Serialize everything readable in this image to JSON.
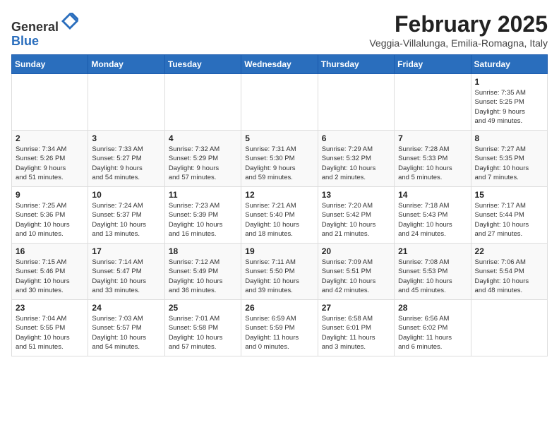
{
  "header": {
    "logo_line1": "General",
    "logo_line2": "Blue",
    "month_year": "February 2025",
    "location": "Veggia-Villalunga, Emilia-Romagna, Italy"
  },
  "weekdays": [
    "Sunday",
    "Monday",
    "Tuesday",
    "Wednesday",
    "Thursday",
    "Friday",
    "Saturday"
  ],
  "weeks": [
    [
      {
        "day": "",
        "info": ""
      },
      {
        "day": "",
        "info": ""
      },
      {
        "day": "",
        "info": ""
      },
      {
        "day": "",
        "info": ""
      },
      {
        "day": "",
        "info": ""
      },
      {
        "day": "",
        "info": ""
      },
      {
        "day": "1",
        "info": "Sunrise: 7:35 AM\nSunset: 5:25 PM\nDaylight: 9 hours\nand 49 minutes."
      }
    ],
    [
      {
        "day": "2",
        "info": "Sunrise: 7:34 AM\nSunset: 5:26 PM\nDaylight: 9 hours\nand 51 minutes."
      },
      {
        "day": "3",
        "info": "Sunrise: 7:33 AM\nSunset: 5:27 PM\nDaylight: 9 hours\nand 54 minutes."
      },
      {
        "day": "4",
        "info": "Sunrise: 7:32 AM\nSunset: 5:29 PM\nDaylight: 9 hours\nand 57 minutes."
      },
      {
        "day": "5",
        "info": "Sunrise: 7:31 AM\nSunset: 5:30 PM\nDaylight: 9 hours\nand 59 minutes."
      },
      {
        "day": "6",
        "info": "Sunrise: 7:29 AM\nSunset: 5:32 PM\nDaylight: 10 hours\nand 2 minutes."
      },
      {
        "day": "7",
        "info": "Sunrise: 7:28 AM\nSunset: 5:33 PM\nDaylight: 10 hours\nand 5 minutes."
      },
      {
        "day": "8",
        "info": "Sunrise: 7:27 AM\nSunset: 5:35 PM\nDaylight: 10 hours\nand 7 minutes."
      }
    ],
    [
      {
        "day": "9",
        "info": "Sunrise: 7:25 AM\nSunset: 5:36 PM\nDaylight: 10 hours\nand 10 minutes."
      },
      {
        "day": "10",
        "info": "Sunrise: 7:24 AM\nSunset: 5:37 PM\nDaylight: 10 hours\nand 13 minutes."
      },
      {
        "day": "11",
        "info": "Sunrise: 7:23 AM\nSunset: 5:39 PM\nDaylight: 10 hours\nand 16 minutes."
      },
      {
        "day": "12",
        "info": "Sunrise: 7:21 AM\nSunset: 5:40 PM\nDaylight: 10 hours\nand 18 minutes."
      },
      {
        "day": "13",
        "info": "Sunrise: 7:20 AM\nSunset: 5:42 PM\nDaylight: 10 hours\nand 21 minutes."
      },
      {
        "day": "14",
        "info": "Sunrise: 7:18 AM\nSunset: 5:43 PM\nDaylight: 10 hours\nand 24 minutes."
      },
      {
        "day": "15",
        "info": "Sunrise: 7:17 AM\nSunset: 5:44 PM\nDaylight: 10 hours\nand 27 minutes."
      }
    ],
    [
      {
        "day": "16",
        "info": "Sunrise: 7:15 AM\nSunset: 5:46 PM\nDaylight: 10 hours\nand 30 minutes."
      },
      {
        "day": "17",
        "info": "Sunrise: 7:14 AM\nSunset: 5:47 PM\nDaylight: 10 hours\nand 33 minutes."
      },
      {
        "day": "18",
        "info": "Sunrise: 7:12 AM\nSunset: 5:49 PM\nDaylight: 10 hours\nand 36 minutes."
      },
      {
        "day": "19",
        "info": "Sunrise: 7:11 AM\nSunset: 5:50 PM\nDaylight: 10 hours\nand 39 minutes."
      },
      {
        "day": "20",
        "info": "Sunrise: 7:09 AM\nSunset: 5:51 PM\nDaylight: 10 hours\nand 42 minutes."
      },
      {
        "day": "21",
        "info": "Sunrise: 7:08 AM\nSunset: 5:53 PM\nDaylight: 10 hours\nand 45 minutes."
      },
      {
        "day": "22",
        "info": "Sunrise: 7:06 AM\nSunset: 5:54 PM\nDaylight: 10 hours\nand 48 minutes."
      }
    ],
    [
      {
        "day": "23",
        "info": "Sunrise: 7:04 AM\nSunset: 5:55 PM\nDaylight: 10 hours\nand 51 minutes."
      },
      {
        "day": "24",
        "info": "Sunrise: 7:03 AM\nSunset: 5:57 PM\nDaylight: 10 hours\nand 54 minutes."
      },
      {
        "day": "25",
        "info": "Sunrise: 7:01 AM\nSunset: 5:58 PM\nDaylight: 10 hours\nand 57 minutes."
      },
      {
        "day": "26",
        "info": "Sunrise: 6:59 AM\nSunset: 5:59 PM\nDaylight: 11 hours\nand 0 minutes."
      },
      {
        "day": "27",
        "info": "Sunrise: 6:58 AM\nSunset: 6:01 PM\nDaylight: 11 hours\nand 3 minutes."
      },
      {
        "day": "28",
        "info": "Sunrise: 6:56 AM\nSunset: 6:02 PM\nDaylight: 11 hours\nand 6 minutes."
      },
      {
        "day": "",
        "info": ""
      }
    ]
  ]
}
